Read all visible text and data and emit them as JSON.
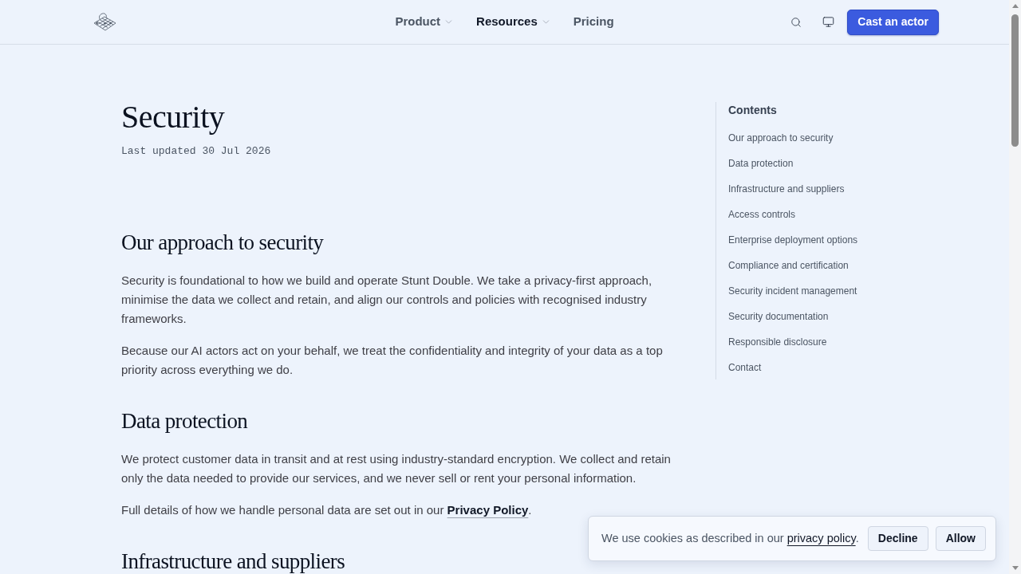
{
  "header": {
    "nav": [
      {
        "label": "Product",
        "dropdown": true,
        "selected": false
      },
      {
        "label": "Resources",
        "dropdown": true,
        "selected": true
      },
      {
        "label": "Pricing",
        "dropdown": false,
        "selected": false
      }
    ],
    "cta": "Cast an actor"
  },
  "article": {
    "title": "Security",
    "updated": "Last updated 30 Jul 2026",
    "sections": [
      {
        "heading": "Our approach to security",
        "paragraphs": [
          {
            "text": "Security is foundational to how we build and operate Stunt Double. We take a privacy-first approach, minimise the data we collect and retain, and align our controls and policies with recognised industry frameworks."
          },
          {
            "text": "Because our AI actors act on your behalf, we treat the confidentiality and integrity of your data as a top priority across everything we do."
          }
        ]
      },
      {
        "heading": "Data protection",
        "paragraphs": [
          {
            "text": "We protect customer data in transit and at rest using industry-standard encryption. We collect and retain only the data needed to provide our services, and we never sell or rent your personal information."
          },
          {
            "text": "Full details of how we handle personal data are set out in our",
            "link": "Privacy Policy",
            "after": "."
          }
        ]
      },
      {
        "heading": "Infrastructure and suppliers"
      }
    ]
  },
  "toc": {
    "title": "Contents",
    "items": [
      "Our approach to security",
      "Data protection",
      "Infrastructure and suppliers",
      "Access controls",
      "Enterprise deployment options",
      "Compliance and certification",
      "Security incident management",
      "Security documentation",
      "Responsible disclosure",
      "Contact"
    ]
  },
  "cookie_banner": {
    "text": "We use cookies as described in our",
    "link": "privacy policy",
    "after": ".",
    "buttons": [
      "Decline",
      "Allow"
    ]
  }
}
